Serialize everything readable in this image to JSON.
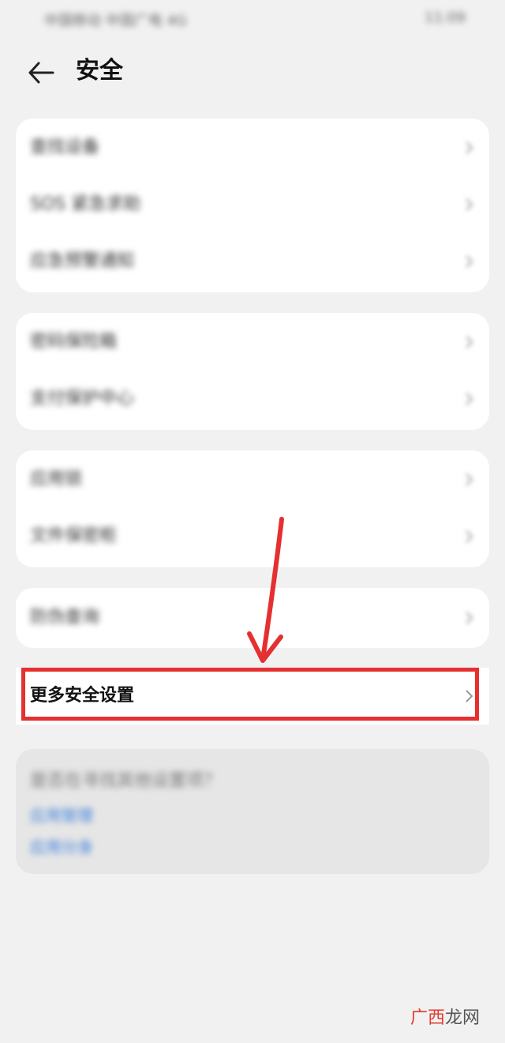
{
  "status_bar": {
    "carrier_text": "中国移动 中国广电 4G",
    "time_text": "11:09"
  },
  "header": {
    "back_icon": "arrow-left-icon",
    "title": "安全"
  },
  "group1": {
    "items": [
      {
        "label": "查找设备"
      },
      {
        "label": "SOS 紧急求助"
      },
      {
        "label": "应急预警通知"
      }
    ]
  },
  "group2": {
    "items": [
      {
        "label": "密码保险箱"
      },
      {
        "label": "支付保护中心"
      }
    ]
  },
  "group3": {
    "items": [
      {
        "label": "应用锁"
      },
      {
        "label": "文件保密柜"
      }
    ]
  },
  "group4": {
    "items": [
      {
        "label": "防伪查询"
      }
    ]
  },
  "group5": {
    "items": [
      {
        "label": "更多安全设置"
      }
    ]
  },
  "tip": {
    "question": "是否在寻找其他设置项？",
    "link1": "应用管理",
    "link2": "应用分身"
  },
  "watermark": {
    "part1": "广西",
    "part2": "龙网"
  },
  "colors": {
    "highlight": "#e53030",
    "link": "#3d7fdc",
    "background": "#f1f1f1"
  }
}
